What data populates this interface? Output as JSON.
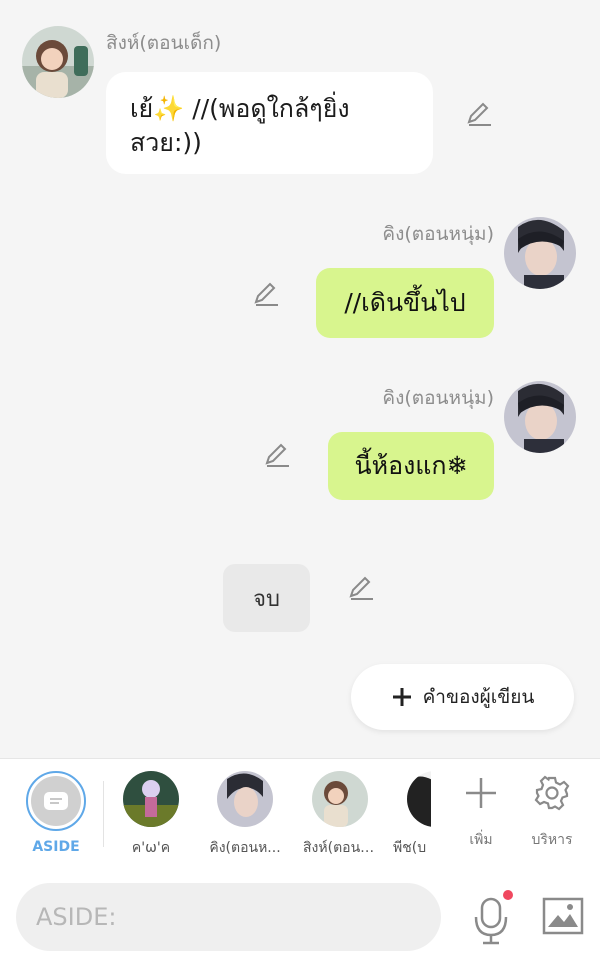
{
  "messages": [
    {
      "speaker": "สิงห์(ตอนเด็ก)",
      "text_line1": "เย้✨ //(พอดูใกล้ๆยิ่ง",
      "text_line2": "สวย:))"
    },
    {
      "speaker": "คิง(ตอนหนุ่ม)",
      "text": "//เดินขึ้นไป"
    },
    {
      "speaker": "คิง(ตอนหนุ่ม)",
      "text": "นี้ห้องแก❄"
    },
    {
      "narration": "จบ"
    }
  ],
  "author_button": {
    "label": "คำของผู้เขียน"
  },
  "tray": {
    "aside_label": "ASIDE",
    "characters": [
      {
        "label": "ค'ω'ค"
      },
      {
        "label": "คิง(ตอนห..."
      },
      {
        "label": "สิงห์(ตอนเ..."
      },
      {
        "label": "พีช(บ"
      }
    ],
    "add_label": "เพิ่ม",
    "manage_label": "บริหาร"
  },
  "input": {
    "placeholder": "ASIDE:"
  },
  "colors": {
    "accent": "#5fa8e8",
    "green_bubble": "#d8f58e",
    "mic_dot": "#f0485f"
  }
}
